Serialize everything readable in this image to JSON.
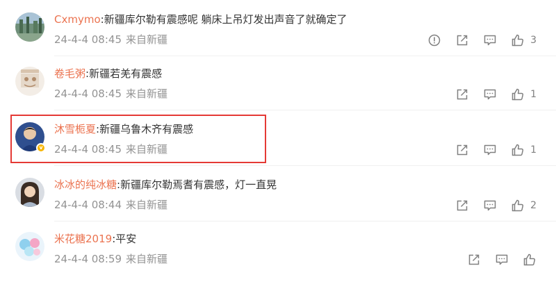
{
  "comments": [
    {
      "username": "Cxmymo",
      "text": "新疆库尔勒有震感呢 躺床上吊灯发出声音了就确定了",
      "time": "24-4-4 08:45",
      "source": "来自新疆",
      "like_count": "3",
      "has_report": true
    },
    {
      "username": "卷毛粥",
      "text": "新疆若羌有震感",
      "time": "24-4-4 08:45",
      "source": "来自新疆",
      "like_count": "1",
      "has_report": false
    },
    {
      "username": "沐雪栀夏",
      "text": "新疆乌鲁木齐有震感",
      "time": "24-4-4 08:45",
      "source": "来自新疆",
      "like_count": "1",
      "has_report": false,
      "verified": true,
      "highlighted": true
    },
    {
      "username": "冰冰的纯冰糖",
      "text": "新疆库尔勒焉耆有震感，灯一直晃",
      "time": "24-4-4 08:44",
      "source": "来自新疆",
      "like_count": "2",
      "has_report": false
    },
    {
      "username": "米花糖2019",
      "text": "平安",
      "time": "24-4-4 08:59",
      "source": "来自新疆",
      "like_count": "",
      "has_report": false
    }
  ],
  "colors": {
    "username": "#eb7350",
    "meta": "#939393",
    "icon": "#808080",
    "highlight_border": "#e53935"
  },
  "icons": {
    "report": "exclamation-circle-icon",
    "share": "share-icon",
    "comment": "comment-icon",
    "like": "thumbs-up-icon"
  }
}
